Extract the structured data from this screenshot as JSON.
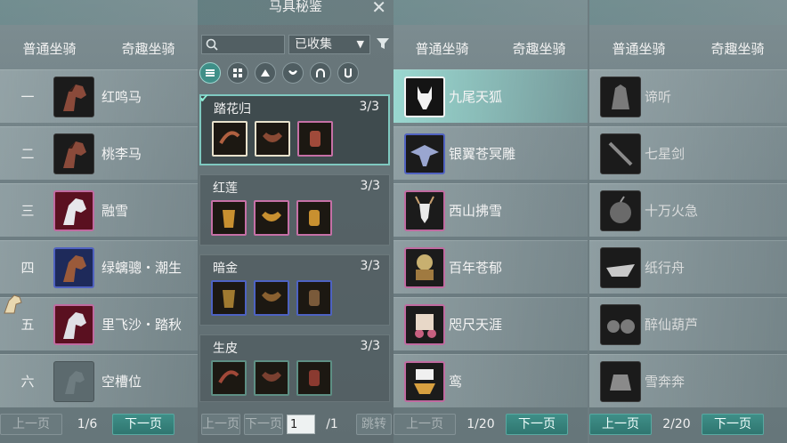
{
  "panel1": {
    "tabs": [
      "普通坐骑",
      "奇趣坐骑"
    ],
    "rows": [
      {
        "num": "一",
        "name": "红鸣马",
        "icon": "horse-icon"
      },
      {
        "num": "二",
        "name": "桃李马",
        "icon": "horse-icon"
      },
      {
        "num": "三",
        "name": "融雪",
        "icon": "horse-icon"
      },
      {
        "num": "四",
        "name": "绿螭骢・潮生",
        "icon": "horse-icon"
      },
      {
        "num": "五",
        "name": "里飞沙・踏秋",
        "icon": "horse-icon"
      },
      {
        "num": "六",
        "name": "空槽位",
        "icon": "empty-slot-icon"
      }
    ],
    "pager": {
      "prev": "上一页",
      "page": "1/6",
      "next": "下一页"
    }
  },
  "panel2": {
    "title": "马具秘鉴",
    "dropdown": "已收集",
    "sets": [
      {
        "name": "踏花归",
        "count": "3/3"
      },
      {
        "name": "红莲",
        "count": "3/3"
      },
      {
        "name": "暗金",
        "count": "3/3"
      },
      {
        "name": "生皮",
        "count": "3/3"
      }
    ],
    "pager": {
      "prev": "上一页",
      "next": "下一页",
      "page_input": "1",
      "total": "/1",
      "jump": "跳转"
    }
  },
  "panel3": {
    "tabs": [
      "普通坐骑",
      "奇趣坐骑"
    ],
    "rows": [
      {
        "name": "九尾天狐"
      },
      {
        "name": "银翼苍冥雕"
      },
      {
        "name": "西山拂雪"
      },
      {
        "name": "百年苍郁"
      },
      {
        "name": "咫尺天涯"
      },
      {
        "name": "鸾"
      }
    ],
    "pager": {
      "prev": "上一页",
      "page": "1/20",
      "next": "下一页"
    }
  },
  "panel4": {
    "tabs": [
      "普通坐骑",
      "奇趣坐骑"
    ],
    "rows": [
      {
        "name": "谛听"
      },
      {
        "name": "七星剑"
      },
      {
        "name": "十万火急"
      },
      {
        "name": "纸行舟"
      },
      {
        "name": "醉仙葫芦"
      },
      {
        "name": "雪奔奔"
      }
    ],
    "pager": {
      "prev": "上一页",
      "page": "2/20",
      "next": "下一页"
    }
  },
  "colors": {
    "accent": "#3f8f88",
    "selected_border": "#7fc9c0"
  }
}
